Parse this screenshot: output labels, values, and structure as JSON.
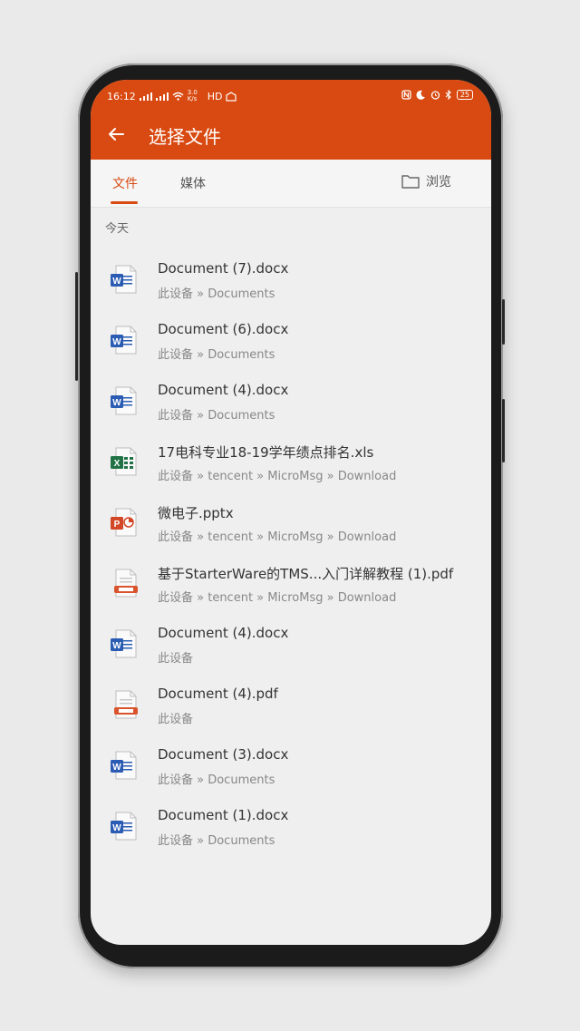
{
  "status": {
    "time": "16:12",
    "speed": "3.0 K/s",
    "hd": "HD",
    "battery": "25"
  },
  "header": {
    "title": "选择文件"
  },
  "tabs": {
    "files": "文件",
    "media": "媒体",
    "browse": "浏览"
  },
  "section_label": "今天",
  "files": [
    {
      "name": "Document (7).docx",
      "path": "此设备 » Documents",
      "type": "word"
    },
    {
      "name": "Document (6).docx",
      "path": "此设备 » Documents",
      "type": "word"
    },
    {
      "name": "Document (4).docx",
      "path": "此设备 » Documents",
      "type": "word"
    },
    {
      "name": "17电科专业18-19学年绩点排名.xls",
      "path": "此设备 » tencent » MicroMsg » Download",
      "type": "excel"
    },
    {
      "name": "微电子.pptx",
      "path": "此设备 » tencent » MicroMsg » Download",
      "type": "ppt"
    },
    {
      "name": "基于StarterWare的TMS...入门详解教程 (1).pdf",
      "path": "此设备 » tencent » MicroMsg » Download",
      "type": "pdf"
    },
    {
      "name": "Document (4).docx",
      "path": "此设备",
      "type": "word"
    },
    {
      "name": "Document (4).pdf",
      "path": "此设备",
      "type": "pdf"
    },
    {
      "name": "Document (3).docx",
      "path": "此设备 » Documents",
      "type": "word"
    },
    {
      "name": "Document (1).docx",
      "path": "此设备 » Documents",
      "type": "word"
    }
  ],
  "colors": {
    "accent": "#d84a11",
    "word": "#2b5cb3",
    "excel": "#217346",
    "ppt": "#d24726",
    "pdf": "#d9532c"
  }
}
